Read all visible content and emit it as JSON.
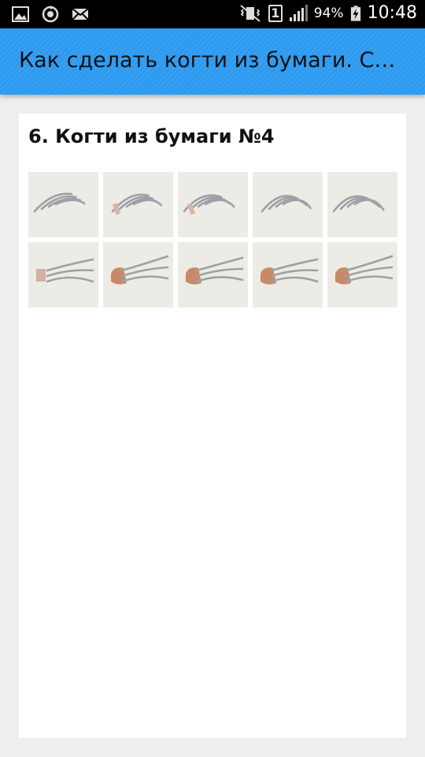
{
  "status_bar": {
    "battery_percent": "94%",
    "time": "10:48",
    "sim_slot": "1",
    "icons": [
      "gallery-icon",
      "sync-icon",
      "mail-icon",
      "vibrate-icon",
      "sim-icon",
      "signal-icon",
      "battery-charging-icon"
    ]
  },
  "app_bar": {
    "title": "Как сделать когти из бумаги. С…"
  },
  "article": {
    "title": "6. Когти из бумаги №4",
    "images": [
      {
        "name": "step-1"
      },
      {
        "name": "step-2"
      },
      {
        "name": "step-3"
      },
      {
        "name": "step-4"
      },
      {
        "name": "step-5"
      },
      {
        "name": "step-6"
      },
      {
        "name": "step-7"
      },
      {
        "name": "step-8"
      },
      {
        "name": "step-9"
      },
      {
        "name": "step-10"
      }
    ]
  },
  "colors": {
    "app_bar": "#2d9af0",
    "background": "#eeeeee",
    "card": "#ffffff"
  }
}
